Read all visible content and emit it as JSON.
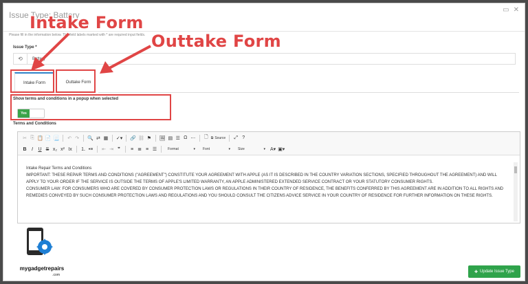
{
  "modal": {
    "title": "Issue Type: Battery",
    "helper_text": "Please fill in the information below. The field labels marked with * are required input fields.",
    "window_controls": [
      "maximize-icon",
      "close-icon"
    ]
  },
  "issue_type": {
    "label": "Issue Type *",
    "value": "Battery"
  },
  "tabs": [
    {
      "label": "Intake Form",
      "active": true
    },
    {
      "label": "Outtake Form",
      "active": false
    }
  ],
  "popup_setting": {
    "label": "Show terms and conditions in a popup when selected",
    "toggle_value": "Yes"
  },
  "terms": {
    "label": "Terms and Conditions",
    "toolbar": {
      "source_label": "Source",
      "format_label": "Format",
      "font_label": "Font",
      "size_label": "Size"
    },
    "content": [
      "Intake Repair Terms and Conditions",
      "IMPORTANT: THESE REPAIR TERMS AND CONDITIONS (\"AGREEMENT\") CONSTITUTE YOUR AGREEMENT WITH APPLE (AS IT IS DESCRIBED IN THE COUNTRY VARIATION SECTIONS, SPECIFIED THROUGHOUT THE AGREEMENT) AND WILL APPLY TO YOUR ORDER IF THE SERVICE IS OUTSIDE THE TERMS OF APPLE'S LIMITED WARRANTY, AN APPLE ADMINISTERED EXTENDED SERVICE CONTRACT OR YOUR STATUTORY CONSUMER RIGHTS.",
      "CONSUMER LAW: FOR CONSUMERS WHO ARE COVERED BY CONSUMER PROTECTION LAWS OR REGULATIONS IN THEIR COUNTRY OF RESIDENCE, THE BENEFITS CONFERRED BY THIS AGREEMENT ARE IN ADDITION TO ALL RIGHTS AND REMEDIES CONVEYED BY SUCH CONSUMER PROTECTION LAWS AND REGULATIONS AND YOU SHOULD CONSULT THE CITIZENS ADVICE SERVICE IN YOUR COUNTRY OF RESIDENCE FOR FURTHER INFORMATION ON THESE RIGHTS."
    ]
  },
  "footer": {
    "update_button": "Update Issue Type"
  },
  "annotations": {
    "intake": "Intake Form",
    "outtake": "Outtake Form"
  },
  "logo": {
    "text": "mygadgetrepairs",
    "suffix": ".com"
  },
  "colors": {
    "accent": "#2f82c8",
    "success": "#3aa44a",
    "annotation": "#e04545"
  }
}
